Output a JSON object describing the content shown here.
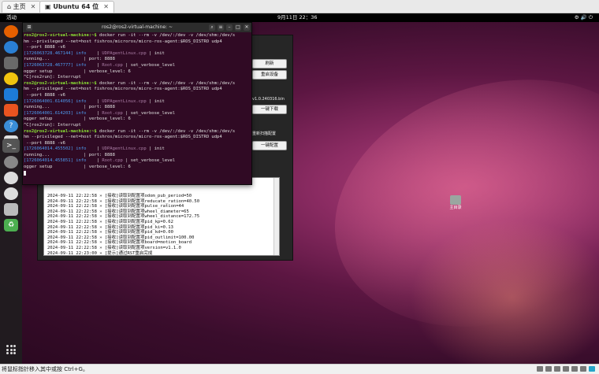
{
  "host": {
    "tab_home": "主页",
    "tab_vm": "Ubuntu 64 位",
    "status_hint": "将鼠标指针移入其中或按 Ctrl+G。"
  },
  "topbar": {
    "activities": "活动",
    "clock": "9月11日 22：36"
  },
  "desktop": {
    "trash_label": "主目录"
  },
  "terminal": {
    "title": "ros2@ros2-virtual-machine: ~",
    "lines": [
      {
        "kind": "cmd",
        "prompt": "ros2@ros2-virtual-machine:~$ ",
        "text": "docker run -it --rm -v /dev/:/dev -v /dev/shm:/dev/s"
      },
      {
        "kind": "plain",
        "text": "hm --privileged --net=host fishros/microros/micro-ros-agent:$ROS_DISTRO udp4"
      },
      {
        "kind": "plain",
        "text": " --port 8888 -v6"
      },
      {
        "kind": "log",
        "ts": "[1726063728.467144]",
        "lvl": "info",
        "src": "UDPAgentLinux.cpp",
        "text": "init"
      },
      {
        "kind": "plain",
        "text": "running...             | port: 8888"
      },
      {
        "kind": "log",
        "ts": "[1726063728.467777]",
        "lvl": "info",
        "src": "Root.cpp",
        "text": "set_verbose_level"
      },
      {
        "kind": "plain",
        "text": "ogger setup            | verbose_level: 6"
      },
      {
        "kind": "plain",
        "text": "^C[ros2run]: Interrupt"
      },
      {
        "kind": "cmd",
        "prompt": "ros2@ros2-virtual-machine:~$ ",
        "text": "docker run -it --rm -v /dev/:/dev -v /dev/shm:/dev/s"
      },
      {
        "kind": "plain",
        "text": "hm --privileged --net=host fishros/microros/micro-ros-agent:$ROS_DISTRO udp4"
      },
      {
        "kind": "plain",
        "text": " --port 8888 -v6"
      },
      {
        "kind": "log",
        "ts": "[1726064001.614056]",
        "lvl": "info",
        "src": "UDPAgentLinux.cpp",
        "text": "init"
      },
      {
        "kind": "plain",
        "text": "running...             | port: 8888"
      },
      {
        "kind": "log",
        "ts": "[1726064001.614203]",
        "lvl": "info",
        "src": "Root.cpp",
        "text": "set_verbose_level"
      },
      {
        "kind": "plain",
        "text": "ogger setup            | verbose_level: 6"
      },
      {
        "kind": "plain",
        "text": "^C[ros2run]: Interrupt"
      },
      {
        "kind": "cmd",
        "prompt": "ros2@ros2-virtual-machine:~$ ",
        "text": "docker run -it --rm -v /dev/:/dev -v /dev/shm:/dev/s"
      },
      {
        "kind": "plain",
        "text": "hm --privileged --net=host fishros/microros/micro-ros-agent:$ROS_DISTRO udp4"
      },
      {
        "kind": "plain",
        "text": " --port 8888 -v6"
      },
      {
        "kind": "log",
        "ts": "[1726064014.455502]",
        "lvl": "info",
        "src": "UDPAgentLinux.cpp",
        "text": "init"
      },
      {
        "kind": "plain",
        "text": "running...             | port: 8888"
      },
      {
        "kind": "log",
        "ts": "[1726064014.455851]",
        "lvl": "info",
        "src": "Root.cpp",
        "text": "set_verbose_level"
      },
      {
        "kind": "plain",
        "text": "ogger setup            | verbose_level: 6"
      }
    ]
  },
  "gui": {
    "buttons": [
      "刷新",
      "重启设备",
      "一键下载",
      "一键配置"
    ],
    "labels": [
      "v1.0.240316.bin",
      "重新扫描配置"
    ],
    "log": [
      "2024-09-11 22:22:58 » [接收]读取到配置项odom_pub_period=50",
      "2024-09-11 22:22:58 » [接收]读取到配置项reducate_ration=40.50",
      "2024-09-11 22:22:58 » [接收]读取到配置项pulse_ration=44",
      "2024-09-11 22:22:58 » [接收]读取到配置项wheel_diameter=65",
      "2024-09-11 22:22:58 » [接收]读取到配置项wheel_distance=172.75",
      "2024-09-11 22:22:58 » [接收]读取到配置项pid_kp=0.62",
      "2024-09-11 22:22:58 » [接收]读取到配置项pid_ki=0.13",
      "2024-09-11 22:22:58 » [接收]读取到配置项pid_kd=0.00",
      "2024-09-11 22:22:58 » [接收]读取到配置项pid_outlimit=100.00",
      "2024-09-11 22:22:58 » [接收]读取到配置项board=motion_board",
      "2024-09-11 22:22:58 » [接收]读取到配置项version=v1.1.0",
      "2024-09-11 22:23:00 » [提示]通过RST重启完成"
    ]
  },
  "dock_icons": [
    "firefox-icon",
    "thunderbird-icon",
    "files-icon",
    "rhythmbox-icon",
    "writer-icon",
    "software-icon",
    "help-icon",
    "amazon-icon",
    "terminal-icon",
    "settings-icon",
    "disc-icon",
    "disc-icon",
    "drive-icon",
    "recycle-icon"
  ]
}
